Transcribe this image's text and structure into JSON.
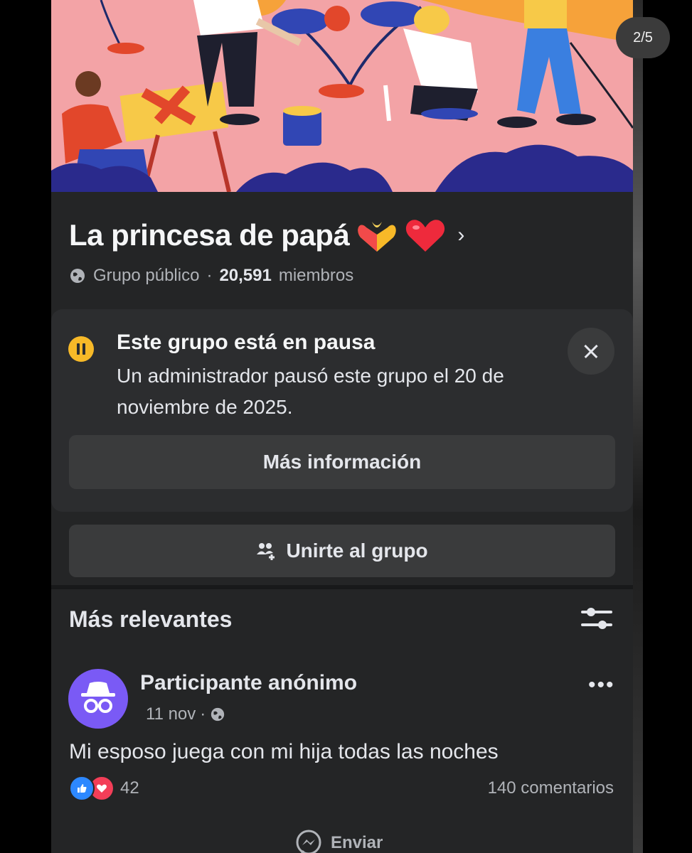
{
  "group": {
    "title": "La princesa de papá",
    "privacy": "Grupo público",
    "member_count": "20,591",
    "member_label": "miembros"
  },
  "pause_notice": {
    "title": "Este grupo está en pausa",
    "description": "Un administrador pausó este grupo el 20 de noviembre de 2025.",
    "more_info_label": "Más información"
  },
  "join_button_label": "Unirte al grupo",
  "feed": {
    "sort_label": "Más relevantes",
    "post": {
      "author": "Participante anónimo",
      "date": "11 nov",
      "text": "Mi esposo juega con mi hija todas las noches",
      "reaction_count": "42",
      "comments": "140 comentarios",
      "send_label": "Enviar"
    }
  },
  "page_indicator": "2/5",
  "colors": {
    "background": "#242526",
    "accent": "#2d88ff",
    "pause": "#f7b928",
    "avatar": "#7a5af5"
  },
  "icons": [
    "globe-icon",
    "pause-icon",
    "close-icon",
    "join-group-icon",
    "filter-icon",
    "incognito-icon",
    "more-icon",
    "like-icon",
    "love-icon",
    "messenger-icon"
  ]
}
